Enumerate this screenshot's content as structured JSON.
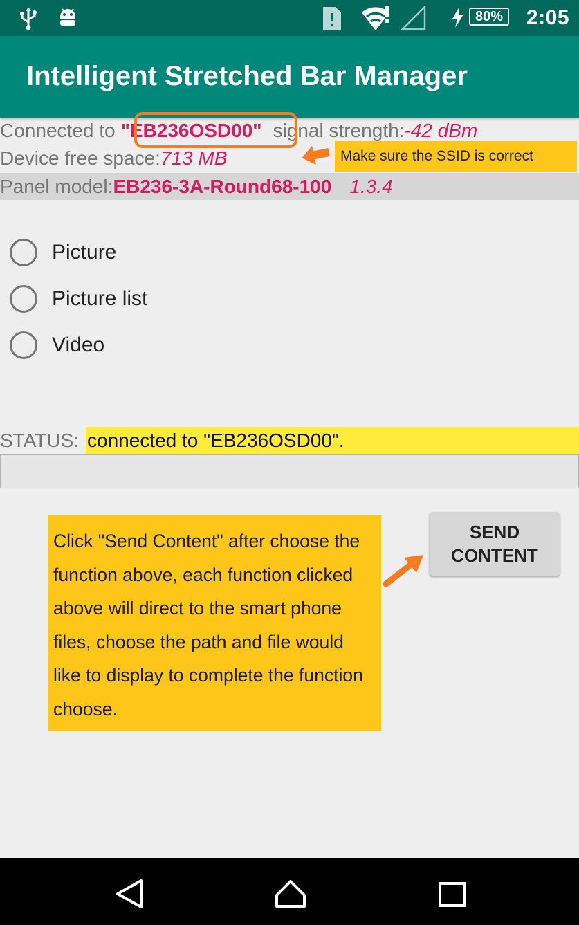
{
  "status_bar": {
    "time": "2:05",
    "battery": "80%",
    "icons": [
      "usb-icon",
      "android-debug-icon",
      "sim-alert-icon",
      "wifi-alert-icon",
      "cell-signal-icon",
      "charging-icon",
      "battery-icon"
    ]
  },
  "app_bar": {
    "title": "Intelligent Stretched Bar Manager"
  },
  "info": {
    "connected_prefix": "Connected to",
    "ssid": "\"EB236OSD00\"",
    "signal_label": "signal strength:",
    "signal_value": "-42 dBm",
    "free_space_label": "Device free space:",
    "free_space_value": "713 MB",
    "panel_label": "Panel model:",
    "panel_model": "EB236-3A-Round68-100",
    "version": "1.3.4"
  },
  "annotations": {
    "ssid_note": "Make sure the SSID is correct",
    "send_note": "Click \"Send Content\" after choose the function above, each function clicked above will direct to the smart phone files, choose the path and file would like to display to complete the function choose."
  },
  "options": [
    {
      "label": "Picture",
      "selected": false
    },
    {
      "label": "Picture list",
      "selected": false
    },
    {
      "label": "Video",
      "selected": false
    }
  ],
  "status": {
    "label": "STATUS:",
    "value": "connected to \"EB236OSD00\"."
  },
  "send_button": {
    "label": "SEND CONTENT"
  },
  "colors": {
    "primary": "#00897b",
    "primary_dark": "#00695c",
    "accent": "#d81b60",
    "callout": "#ffc61a",
    "status_highlight": "#ffeb3b",
    "arrow": "#f57c1f"
  }
}
